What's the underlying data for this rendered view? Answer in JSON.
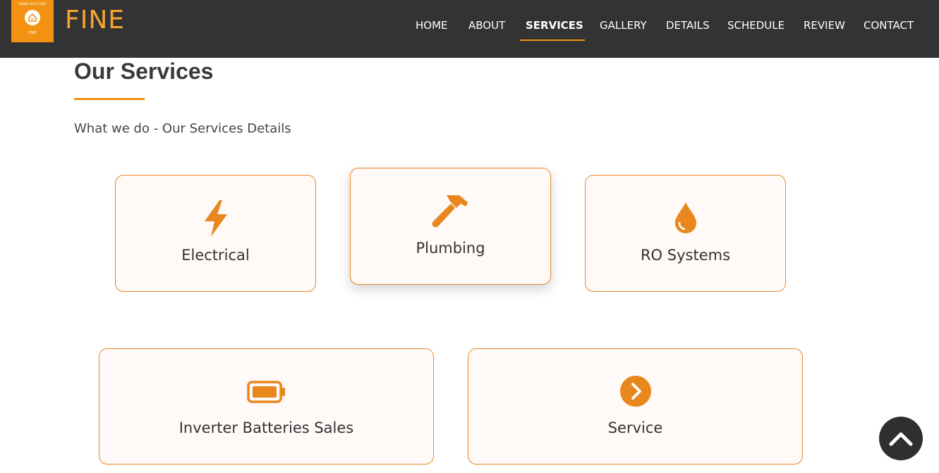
{
  "brand": {
    "name": "FINE",
    "logo_top_text": "POWER SOLUTIONS",
    "logo_bottom_text": "FINE"
  },
  "nav": {
    "items": [
      "HOME",
      "ABOUT",
      "SERVICES",
      "GALLERY",
      "DETAILS",
      "SCHEDULE",
      "REVIEW",
      "CONTACT"
    ],
    "active": "SERVICES"
  },
  "section": {
    "title": "Our Services",
    "subtitle": "What we do - Our Services Details"
  },
  "services": [
    {
      "label": "Electrical",
      "icon": "lightning-bolt-icon"
    },
    {
      "label": "Plumbing",
      "icon": "hammer-icon"
    },
    {
      "label": "RO Systems",
      "icon": "water-drop-icon"
    },
    {
      "label": "Inverter Batteries Sales",
      "icon": "battery-icon"
    },
    {
      "label": "Service",
      "icon": "chevron-right-circle-icon"
    }
  ],
  "colors": {
    "accent": "#f39212",
    "navbar": "#333333",
    "card_background": "#fff9f7",
    "card_border": "#e8872a"
  },
  "scroll_top": {
    "icon": "chevron-up-icon"
  }
}
